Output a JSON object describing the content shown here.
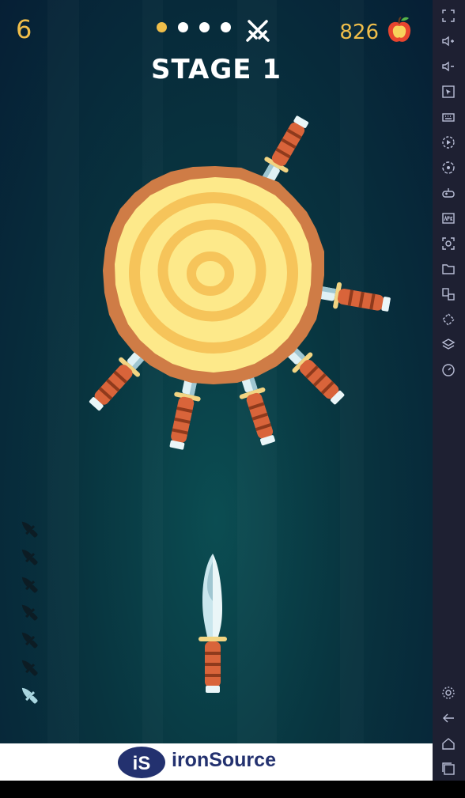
{
  "hud": {
    "level": "6",
    "stage_title": "STAGE 1",
    "stage_dots": [
      {
        "state": "current"
      },
      {
        "state": "pending"
      },
      {
        "state": "pending"
      },
      {
        "state": "pending"
      }
    ],
    "boss_icon": "crossed-swords-icon",
    "apples": "826",
    "apple_icon": "apple-icon"
  },
  "board": {
    "type": "wooden-log-target",
    "stuck_knife_angles_deg": [
      30,
      100,
      135,
      162,
      192,
      222
    ]
  },
  "knives_left": {
    "total": 7,
    "used": 6,
    "remaining": 1
  },
  "ad": {
    "logo_text": "iS",
    "brand": "ironSource"
  },
  "sidebar": {
    "items": [
      {
        "name": "fullscreen-icon"
      },
      {
        "name": "volume-up-icon"
      },
      {
        "name": "volume-down-icon"
      },
      {
        "name": "pointer-icon"
      },
      {
        "name": "keyboard-icon"
      },
      {
        "name": "play-record-icon"
      },
      {
        "name": "sync-icon"
      },
      {
        "name": "gamepad-icon"
      },
      {
        "name": "apk-icon"
      },
      {
        "name": "screenshot-icon"
      },
      {
        "name": "folder-icon"
      },
      {
        "name": "multi-window-icon"
      },
      {
        "name": "rotate-icon"
      },
      {
        "name": "layers-icon"
      },
      {
        "name": "speed-icon"
      },
      {
        "name": "settings-icon"
      },
      {
        "name": "back-icon"
      },
      {
        "name": "home-icon"
      },
      {
        "name": "recents-icon"
      }
    ]
  },
  "colors": {
    "accent_gold": "#f0be4a",
    "wood_bark": "#d07d46",
    "wood_light": "#fde98a",
    "wood_ring": "#f6c45a",
    "handle": "#d9643a",
    "blade": "#dff1f5",
    "sidebar_bg": "#1e2032",
    "ad_navy": "#23316f"
  }
}
